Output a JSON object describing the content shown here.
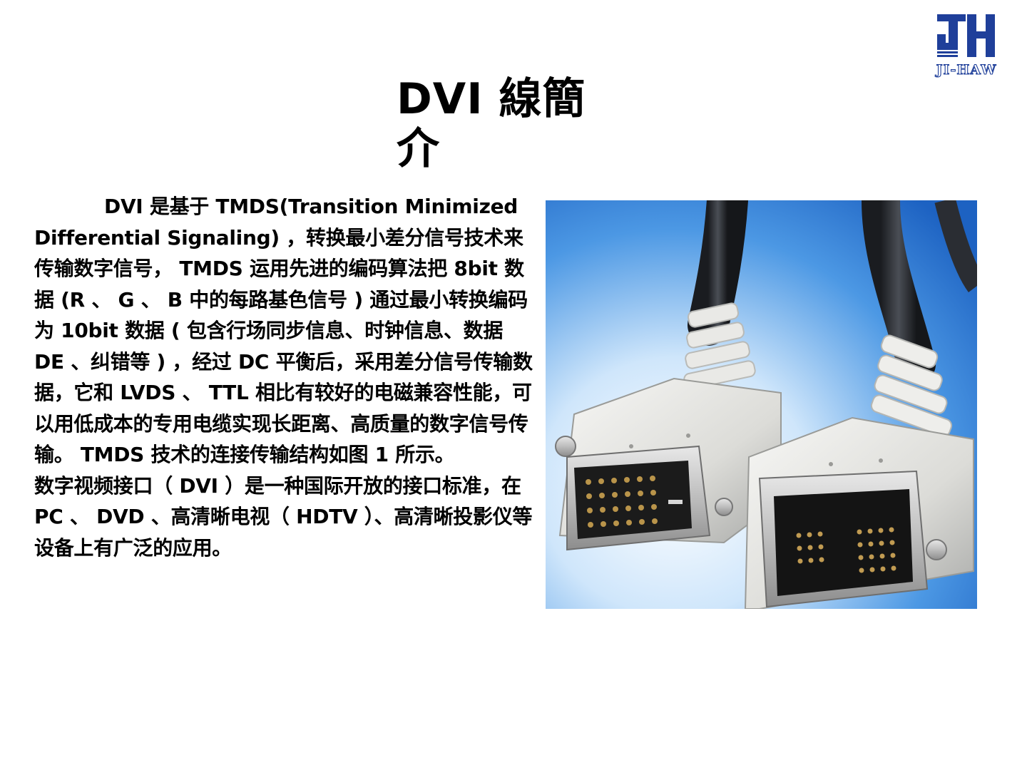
{
  "slide": {
    "title": "DVI 線簡介",
    "paragraph_1": "DVI 是基于 TMDS(Transition Minimized Differential Signaling) ，转换最小差分信号技术来传输数字信号， TMDS 运用先进的编码算法把 8bit 数据 (R 、 G 、 B 中的每路基色信号 ) 通过最小转换编码为 10bit 数据 ( 包含行场同步信息、时钟信息、数据 DE 、纠错等 ) ，经过 DC 平衡后，采用差分信号传输数据，它和 LVDS 、 TTL 相比有较好的电磁兼容性能，可以用低成本的专用电缆实现长距离、高质量的数字信号传输。 TMDS 技术的连接传输结构如图 1 所示。",
    "paragraph_2": "数字视频接口（ DVI ）是一种国际开放的接口标准，在 PC 、 DVD 、高清晰电视（ HDTV ）、高清晰投影仪等设备上有广泛的应用。"
  },
  "logo": {
    "monogram": "JH",
    "wordmark": "JI-HAW",
    "color": "#1f3f9a"
  },
  "photo": {
    "subject": "DVI cable connectors",
    "background_color": "#2f7fd6"
  }
}
